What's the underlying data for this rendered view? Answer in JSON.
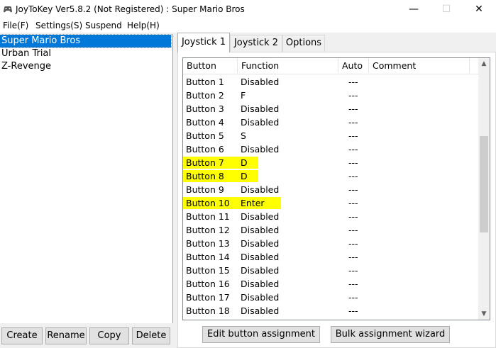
{
  "window": {
    "title": "JoyToKey Ver5.8.2 (Not Registered) : Super Mario Bros",
    "minimize_glyph": "—",
    "maximize_glyph": "☐",
    "close_glyph": "✕"
  },
  "menu": [
    "File(F)",
    "Settings(S)",
    "Suspend",
    "Help(H)"
  ],
  "configs": {
    "selected": "Super Mario Bros",
    "items": [
      "Super Mario Bros",
      "Urban Trial",
      "Z-Revenge"
    ]
  },
  "config_buttons": [
    "Create",
    "Rename",
    "Copy",
    "Delete"
  ],
  "tabs": {
    "active": "Joystick 1",
    "items": [
      "Joystick 1",
      "Joystick 2",
      "Options"
    ]
  },
  "grid": {
    "columns": [
      "Button",
      "Function",
      "Auto",
      "Comment"
    ],
    "rows": [
      {
        "button": "Button 1",
        "function": "Disabled",
        "auto": "---",
        "comment": "",
        "highlighted": false
      },
      {
        "button": "Button 2",
        "function": "F",
        "auto": "---",
        "comment": "",
        "highlighted": false
      },
      {
        "button": "Button 3",
        "function": "Disabled",
        "auto": "---",
        "comment": "",
        "highlighted": false
      },
      {
        "button": "Button 4",
        "function": "Disabled",
        "auto": "---",
        "comment": "",
        "highlighted": false
      },
      {
        "button": "Button 5",
        "function": "S",
        "auto": "---",
        "comment": "",
        "highlighted": false
      },
      {
        "button": "Button 6",
        "function": "Disabled",
        "auto": "---",
        "comment": "",
        "highlighted": false
      },
      {
        "button": "Button 7",
        "function": "D",
        "auto": "---",
        "comment": "",
        "highlighted": true
      },
      {
        "button": "Button 8",
        "function": "D",
        "auto": "---",
        "comment": "",
        "highlighted": true
      },
      {
        "button": "Button 9",
        "function": "Disabled",
        "auto": "---",
        "comment": "",
        "highlighted": false
      },
      {
        "button": "Button 10",
        "function": "Enter",
        "auto": "---",
        "comment": "",
        "highlighted": true
      },
      {
        "button": "Button 11",
        "function": "Disabled",
        "auto": "---",
        "comment": "",
        "highlighted": false
      },
      {
        "button": "Button 12",
        "function": "Disabled",
        "auto": "---",
        "comment": "",
        "highlighted": false
      },
      {
        "button": "Button 13",
        "function": "Disabled",
        "auto": "---",
        "comment": "",
        "highlighted": false
      },
      {
        "button": "Button 14",
        "function": "Disabled",
        "auto": "---",
        "comment": "",
        "highlighted": false
      },
      {
        "button": "Button 15",
        "function": "Disabled",
        "auto": "---",
        "comment": "",
        "highlighted": false
      },
      {
        "button": "Button 16",
        "function": "Disabled",
        "auto": "---",
        "comment": "",
        "highlighted": false
      },
      {
        "button": "Button 17",
        "function": "Disabled",
        "auto": "---",
        "comment": "",
        "highlighted": false
      },
      {
        "button": "Button 18",
        "function": "Disabled",
        "auto": "---",
        "comment": "",
        "highlighted": false
      }
    ],
    "highlight_color": "#ffff00"
  },
  "actions": {
    "edit": "Edit button assignment",
    "bulk": "Bulk assignment wizard"
  },
  "colors": {
    "selection": "#0078d7",
    "highlight": "#ffff00"
  }
}
